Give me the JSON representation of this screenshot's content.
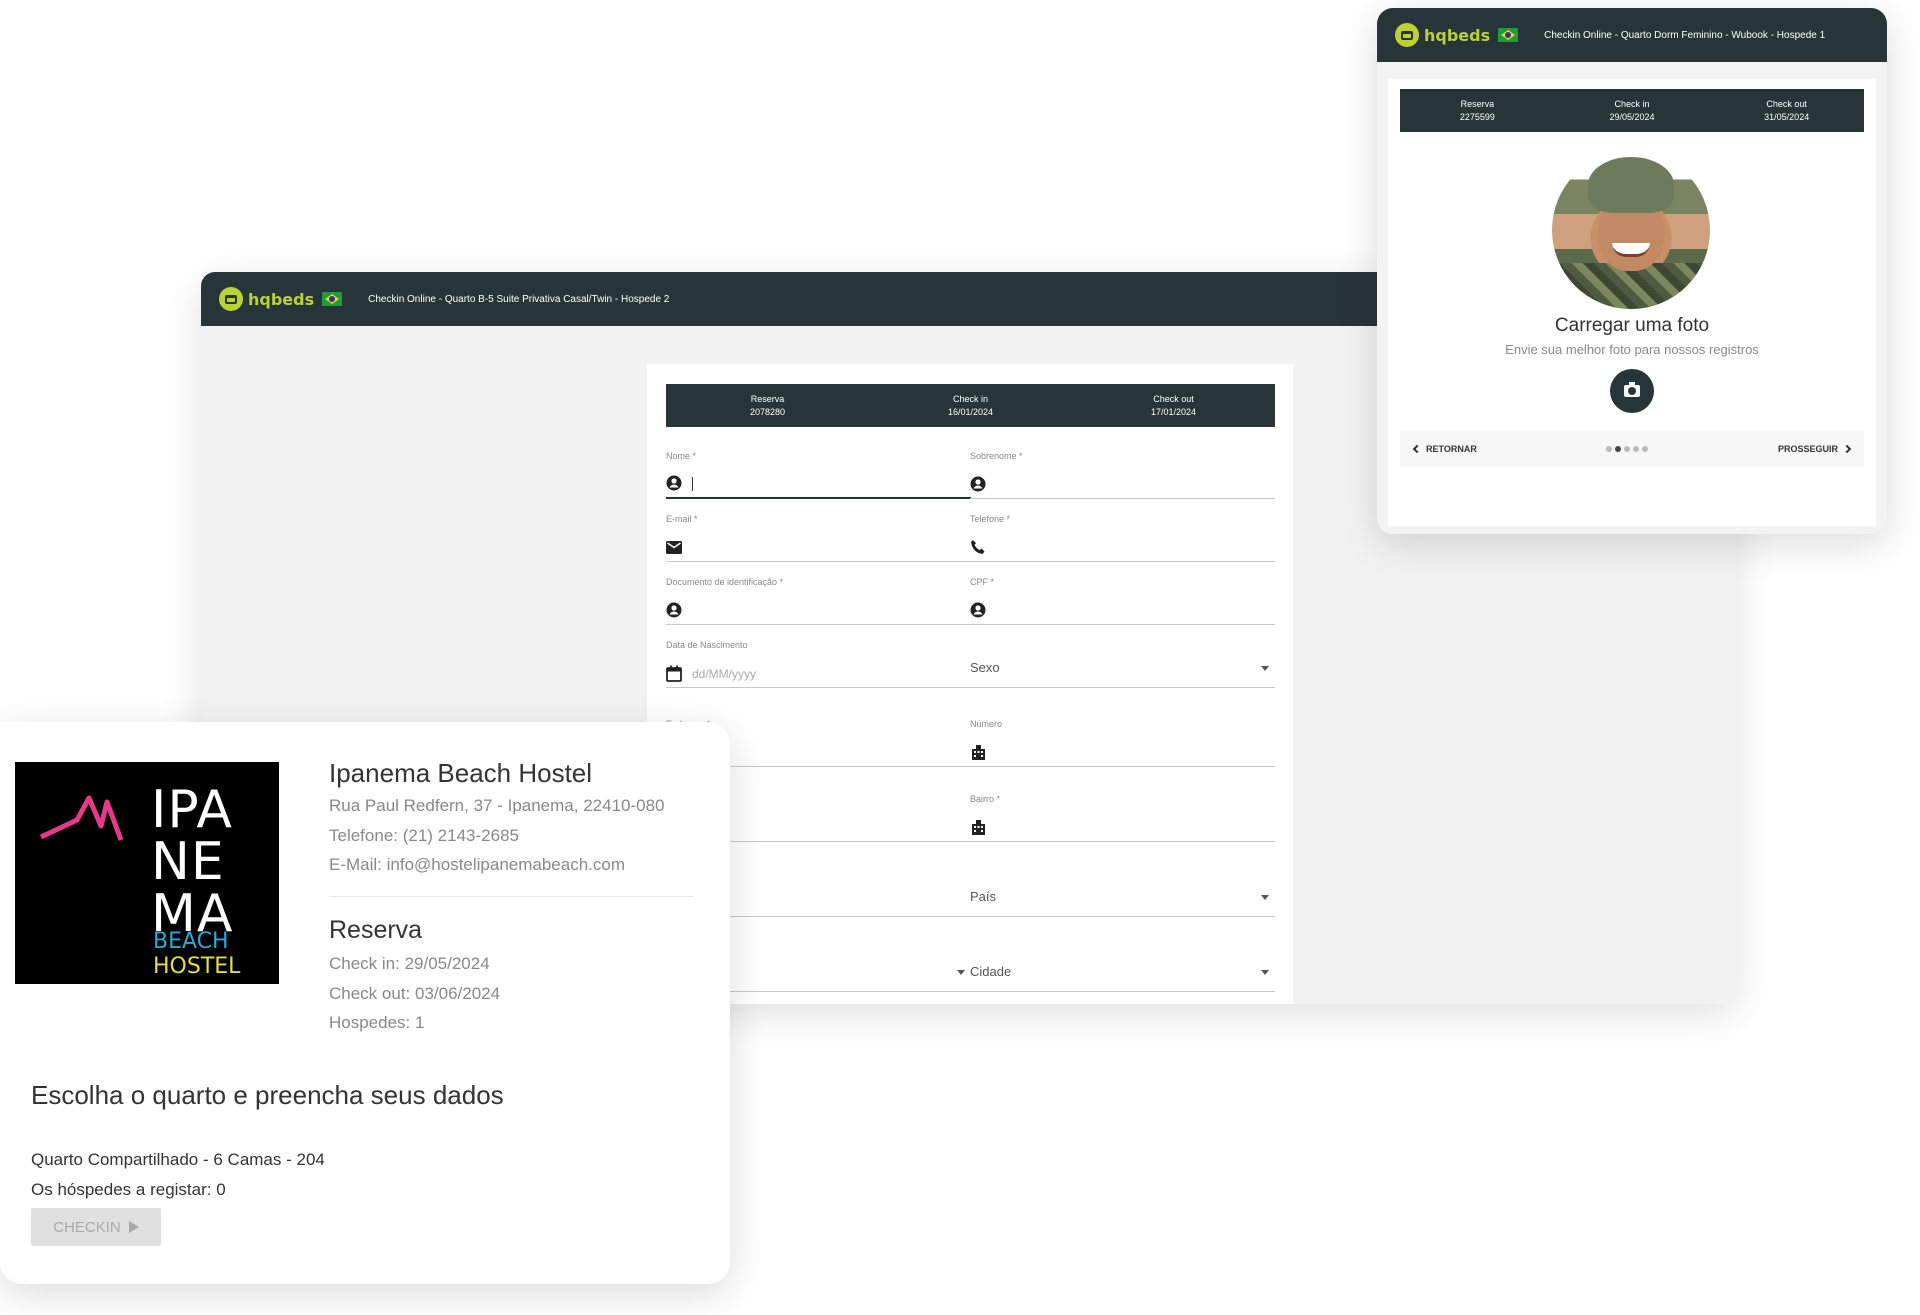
{
  "brand": {
    "name": "hqbeds",
    "accent": "#b9d235",
    "dark": "#283538"
  },
  "main_window": {
    "title": "Checkin Online - Quarto B-5 Suite Privativa Casal/Twin - Hospede 2",
    "summary": [
      {
        "label": "Reserva",
        "value": "2078280"
      },
      {
        "label": "Check in",
        "value": "16/01/2024"
      },
      {
        "label": "Check out",
        "value": "17/01/2024"
      }
    ],
    "fields": {
      "nome": "Nome *",
      "sobrenome": "Sobrenome *",
      "email": "E-mail *",
      "telefone": "Telefone *",
      "documento": "Documento de identificação *",
      "cpf": "CPF *",
      "nascimento": "Data de Nascimento",
      "nascimento_placeholder": "dd/MM/yyyy",
      "sexo": "Sexo",
      "endereco": "Endereço *",
      "numero": "Número",
      "bairro": "Bairro *",
      "pais": "País",
      "cidade": "Cidade"
    }
  },
  "right_window": {
    "title": "Checkin Online - Quarto Dorm Feminino - Wubook - Hospede 1",
    "summary": [
      {
        "label": "Reserva",
        "value": "2275599"
      },
      {
        "label": "Check in",
        "value": "29/05/2024"
      },
      {
        "label": "Check out",
        "value": "31/05/2024"
      }
    ],
    "photo_title": "Carregar uma foto",
    "photo_subtitle": "Envie sua melhor foto para nossos registros",
    "back_label": "RETORNAR",
    "next_label": "PROSSEGUIR",
    "step_count": 5,
    "active_step": 2
  },
  "hostel": {
    "logo_lines": [
      "IPA",
      "NE",
      "MA"
    ],
    "logo_beach": "BEACH",
    "logo_hostel": "HOSTEL",
    "name": "Ipanema Beach Hostel",
    "address": "Rua Paul Redfern, 37 - Ipanema, 22410-080",
    "phone": "Telefone: (21) 2143-2685",
    "email": "E-Mail: info@hostelipanemabeach.com",
    "reservation_title": "Reserva",
    "checkin": "Check in: 29/05/2024",
    "checkout": "Check out: 03/06/2024",
    "guests": "Hospedes: 1",
    "choose_title": "Escolha o quarto e preencha seus dados",
    "room": "Quarto Compartilhado - 6 Camas - 204",
    "guests_to_register": "Os hóspedes a registar: 0",
    "checkin_button": "CHECKIN"
  }
}
